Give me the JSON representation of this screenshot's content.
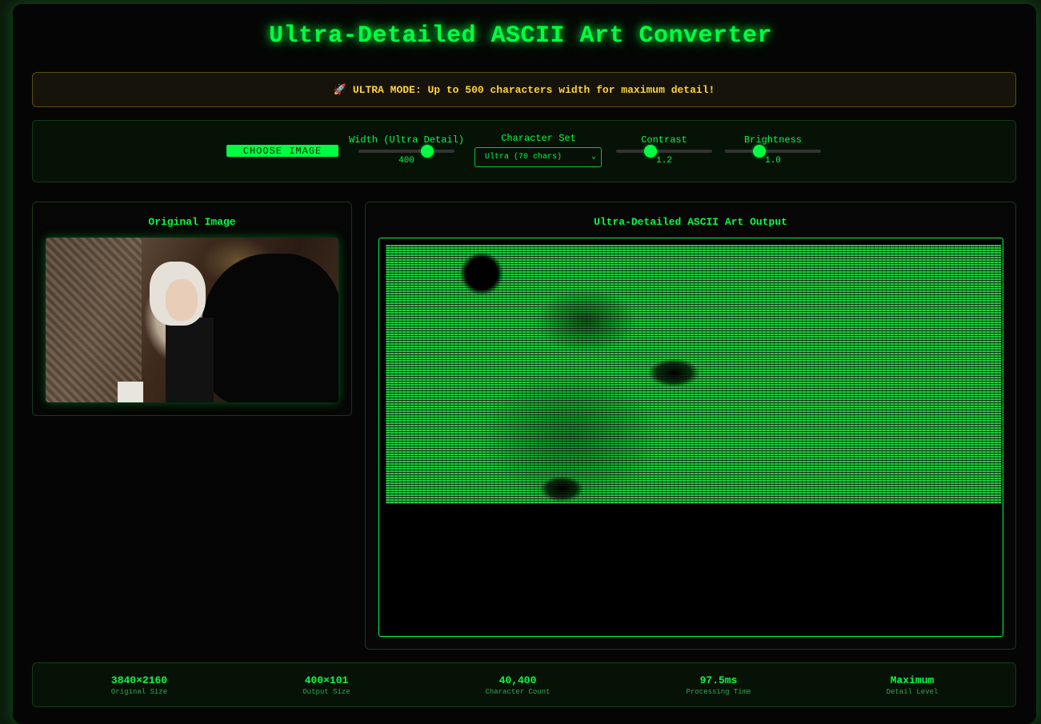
{
  "header": {
    "title": "Ultra-Detailed ASCII Art Converter"
  },
  "banner": {
    "text": "ULTRA MODE: Up to 500 characters width for maximum detail!",
    "icon": "rocket-icon"
  },
  "controls": {
    "choose_label": "CHOOSE IMAGE",
    "width_label": "Width (Ultra Detail)",
    "width_value": "400",
    "width_min": 50,
    "width_max": 500,
    "charset_label": "Character Set",
    "charset_selected": "Ultra (70 chars)",
    "contrast_label": "Contrast",
    "contrast_value": "1.2",
    "brightness_label": "Brightness",
    "brightness_value": "1.0"
  },
  "original_panel": {
    "title": "Original Image"
  },
  "output_panel": {
    "title": "Ultra-Detailed ASCII Art Output"
  },
  "stats": [
    {
      "value": "3840×2160",
      "label": "Original Size"
    },
    {
      "value": "400×101",
      "label": "Output Size"
    },
    {
      "value": "40,400",
      "label": "Character Count"
    },
    {
      "value": "97.5ms",
      "label": "Processing Time"
    },
    {
      "value": "Maximum",
      "label": "Detail Level"
    }
  ],
  "colors": {
    "accent": "#00ff41",
    "warning": "#ffd23a",
    "background": "#050505"
  }
}
